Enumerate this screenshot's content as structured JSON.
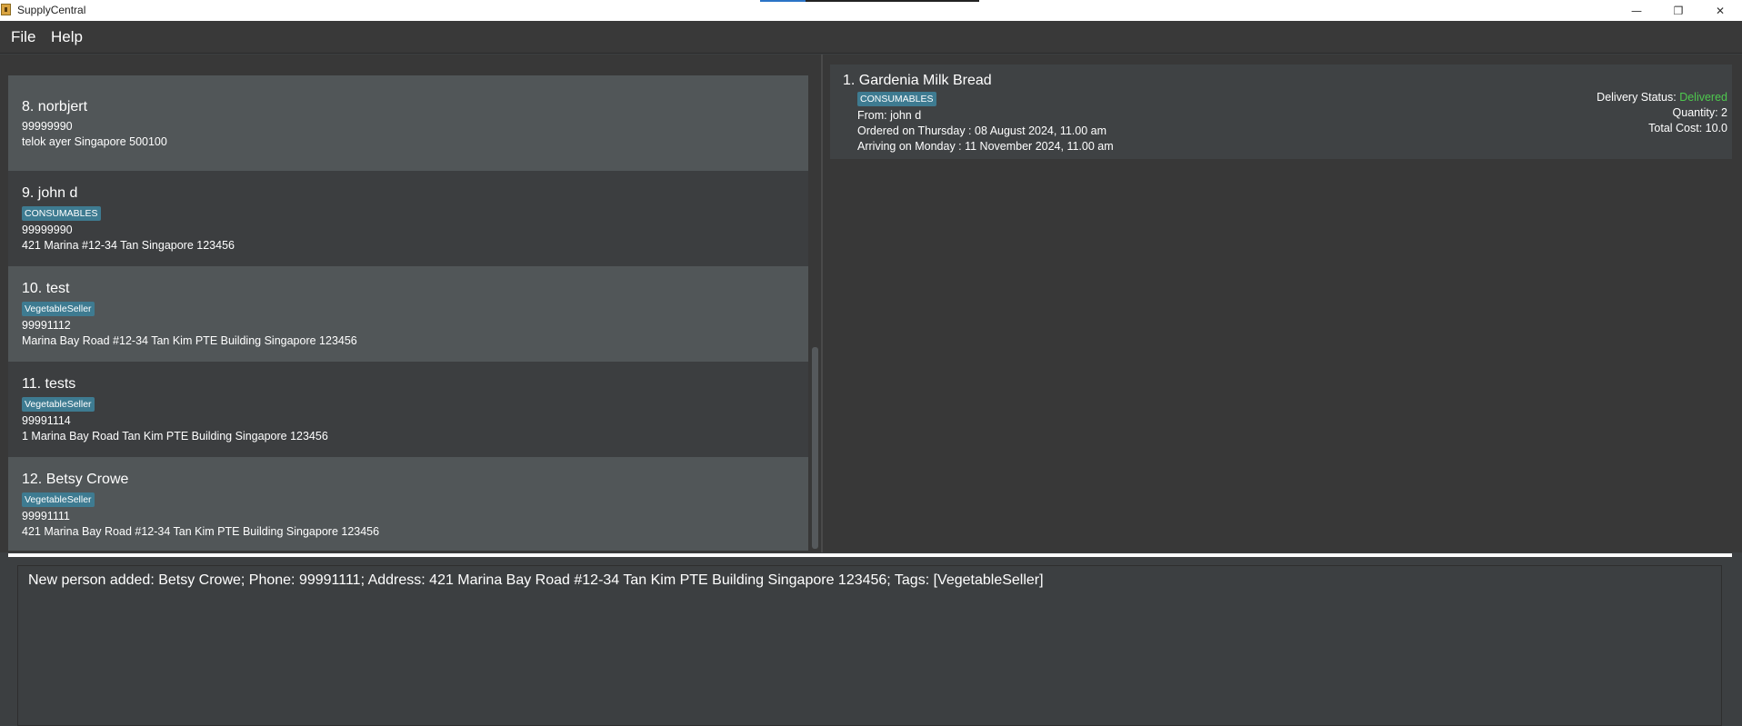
{
  "window": {
    "title": "SupplyCentral",
    "minimize": "—",
    "restore": "❐",
    "close": "✕"
  },
  "menu": {
    "file": "File",
    "help": "Help"
  },
  "persons": [
    {
      "index": "8.",
      "name": "norbjert",
      "tag": "",
      "phone": "99999990",
      "address": "telok ayer Singapore 500100"
    },
    {
      "index": "9.",
      "name": "john d",
      "tag": "CONSUMABLES",
      "phone": "99999990",
      "address": "421 Marina #12-34 Tan Singapore 123456"
    },
    {
      "index": "10.",
      "name": "test",
      "tag": "VegetableSeller",
      "phone": "99991112",
      "address": "Marina Bay Road #12-34 Tan Kim PTE Building Singapore 123456"
    },
    {
      "index": "11.",
      "name": "tests",
      "tag": "VegetableSeller",
      "phone": "99991114",
      "address": "1 Marina Bay Road Tan Kim PTE Building Singapore 123456"
    },
    {
      "index": "12.",
      "name": "Betsy Crowe",
      "tag": "VegetableSeller",
      "phone": "99991111",
      "address": "421 Marina Bay Road #12-34 Tan Kim PTE Building Singapore 123456"
    }
  ],
  "order": {
    "title": "1.  Gardenia Milk Bread",
    "tag": "CONSUMABLES",
    "from": "From: john d",
    "ordered": "Ordered on Thursday : 08 August 2024, 11.00 am",
    "arriving": "Arriving on Monday : 11 November 2024, 11.00 am",
    "status_label": "Delivery Status: ",
    "status_value": "Delivered",
    "quantity": "Quantity: 2",
    "total_cost": "Total Cost: 10.0"
  },
  "result": "New person added: Betsy Crowe; Phone: 99991111; Address: 421 Marina Bay Road #12-34 Tan Kim PTE Building Singapore 123456; Tags: [VegetableSeller]",
  "colors": {
    "tag_bg": "#3e7b91",
    "status_delivered": "#4ec94e",
    "card_light": "#515658",
    "card_dark": "#3c3e40"
  }
}
